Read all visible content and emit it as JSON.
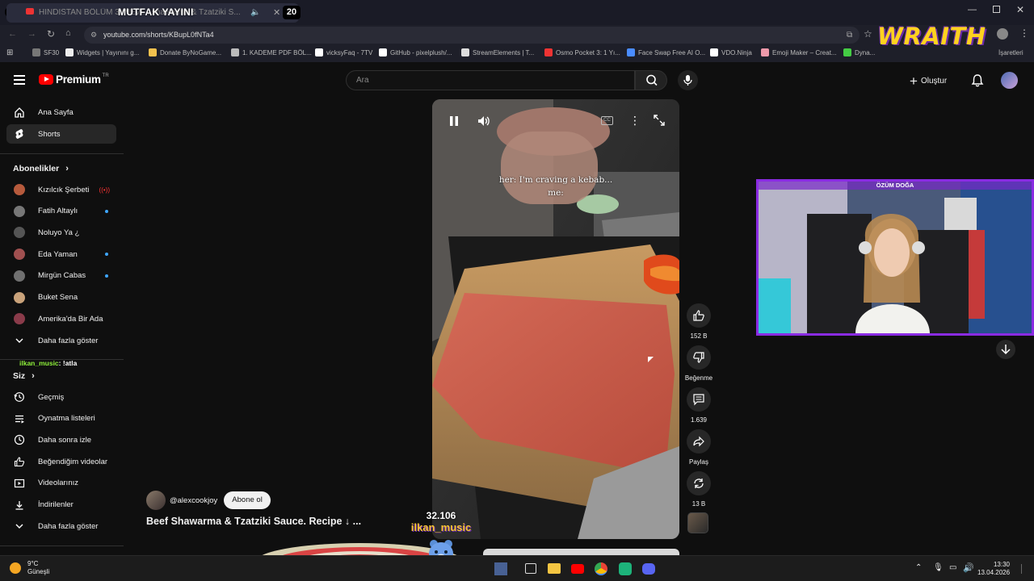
{
  "browser": {
    "tab_counter": "0",
    "tab_title": "HİNDİSTAN BÖLÜM 3: NEVI... shawarma & Tzatziki S...",
    "stream_title": "MUTFAK YAYINI",
    "stream_badge": "20",
    "url": "youtube.com/shorts/KBupL0fNTa4",
    "bookmarks": [
      {
        "label": "SF30",
        "color": "#777"
      },
      {
        "label": "Widgets | Yayınını g...",
        "color": "#eee"
      },
      {
        "label": "Donate ByNoGame...",
        "color": "#f2c14e"
      },
      {
        "label": "1. KADEME PDF BÖL...",
        "color": "#bbb"
      },
      {
        "label": "vicksyFaq - 7TV",
        "color": "#fff"
      },
      {
        "label": "GitHub - pixelplush/...",
        "color": "#fff"
      },
      {
        "label": "StreamElements | T...",
        "color": "#ddd"
      },
      {
        "label": "Osmo Pocket 3: 1 Yı...",
        "color": "#e33"
      },
      {
        "label": "Face Swap Free AI O...",
        "color": "#4a8cff"
      },
      {
        "label": "VDO.Ninja",
        "color": "#fff"
      },
      {
        "label": "Emoji Maker – Creat...",
        "color": "#e9a"
      },
      {
        "label": "Dyna...",
        "color": "#4c4"
      }
    ],
    "bookmarks_end": "İşaretleri",
    "overlay_brand": "WRAITH"
  },
  "youtube": {
    "logo": "Premium",
    "logo_sup": "TR",
    "search_placeholder": "Ara",
    "create_label": "Oluştur",
    "sidebar": {
      "home": "Ana Sayfa",
      "shorts": "Shorts",
      "subscriptions_title": "Abonelikler",
      "subscriptions": [
        {
          "name": "Kızılcık Şerbeti",
          "avatar": "#b65a3c",
          "live": true
        },
        {
          "name": "Fatih Altaylı",
          "avatar": "#777",
          "dot": true
        },
        {
          "name": "Noluyo Ya ¿",
          "avatar": "#555"
        },
        {
          "name": "Eda Yaman",
          "avatar": "#a05050",
          "dot": true
        },
        {
          "name": "Mirgün Cabas",
          "avatar": "#707070",
          "dot": true
        },
        {
          "name": "Buket Sena",
          "avatar": "#c9a27a"
        },
        {
          "name": "Amerika'da Bir Ada",
          "avatar": "#8a3b4a"
        }
      ],
      "show_more": "Daha fazla göster",
      "chat_user": "ilkan_music",
      "chat_msg": ": !atla",
      "you_title": "Siz",
      "you_items": [
        {
          "label": "Geçmiş",
          "icon": "history-icon"
        },
        {
          "label": "Oynatma listeleri",
          "icon": "playlist-icon"
        },
        {
          "label": "Daha sonra izle",
          "icon": "clock-icon"
        },
        {
          "label": "Beğendiğim videolar",
          "icon": "like-icon"
        },
        {
          "label": "Videolarınız",
          "icon": "video-icon"
        },
        {
          "label": "İndirilenler",
          "icon": "download-icon"
        }
      ],
      "show_more_2": "Daha fazla göster"
    },
    "short": {
      "caption_line1": "her: I'm craving a kebab...",
      "caption_line2": "me:",
      "channel": "@alexcookjoy",
      "subscribe": "Abone ol",
      "title": "Beef Shawarma & Tzatziki Sauce. Recipe ↓ ...",
      "likes": "152 B",
      "dislike_label": "Beğenme",
      "comments": "1.639",
      "share_label": "Paylaş",
      "remix_count": "13 B"
    },
    "overlay_count": "32.106",
    "overlay_user": "ilkan_music",
    "cam_label": "ÖZÜM DOĞA"
  },
  "taskbar": {
    "weather_temp": "9°C",
    "weather_desc": "Güneşli",
    "time": "13:30",
    "date": "13.04.2026"
  }
}
